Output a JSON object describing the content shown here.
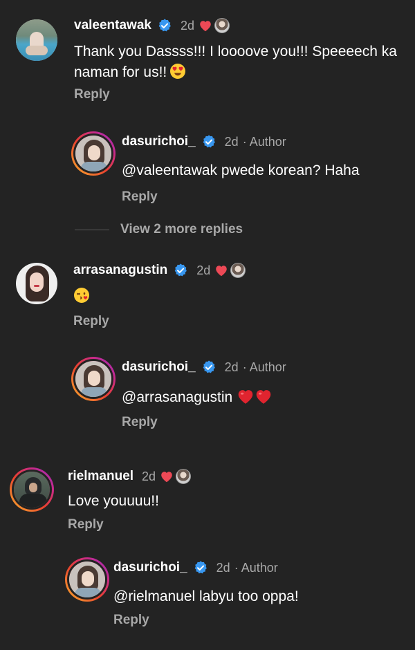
{
  "comments": [
    {
      "username": "valeentawak",
      "time": "2d",
      "text": "Thank you Dassss!!! I loooove you!!! Speeeech ka naman for us!!",
      "reply": "Reply"
    },
    {
      "username": "dasurichoi_",
      "time": "2d",
      "author": "· Author",
      "mention": "@valeentawak",
      "text": " pwede korean? Haha",
      "reply": "Reply"
    },
    {
      "view_more": "View 2 more replies"
    },
    {
      "username": "arrasanagustin",
      "time": "2d",
      "reply": "Reply"
    },
    {
      "username": "dasurichoi_",
      "time": "2d",
      "author": "· Author",
      "mention": "@arrasanagustin",
      "reply": "Reply"
    },
    {
      "username": "rielmanuel",
      "time": "2d",
      "text": "Love youuuu!!",
      "reply": "Reply"
    },
    {
      "username": "dasurichoi_",
      "time": "2d",
      "author": "· Author",
      "mention": "@rielmanuel",
      "text": " labyu too oppa!",
      "reply": "Reply"
    }
  ],
  "colors": {
    "background": "#232323",
    "muted": "#a8a8a8",
    "verified": "#3897f0",
    "heart": "#ed4956"
  },
  "icons": [
    "verified-badge-icon",
    "liked-by-author-heart-icon",
    "author-avatar-mini-icon",
    "heart-emoji",
    "smiling-heart-eyes-emoji",
    "kiss-emoji"
  ]
}
